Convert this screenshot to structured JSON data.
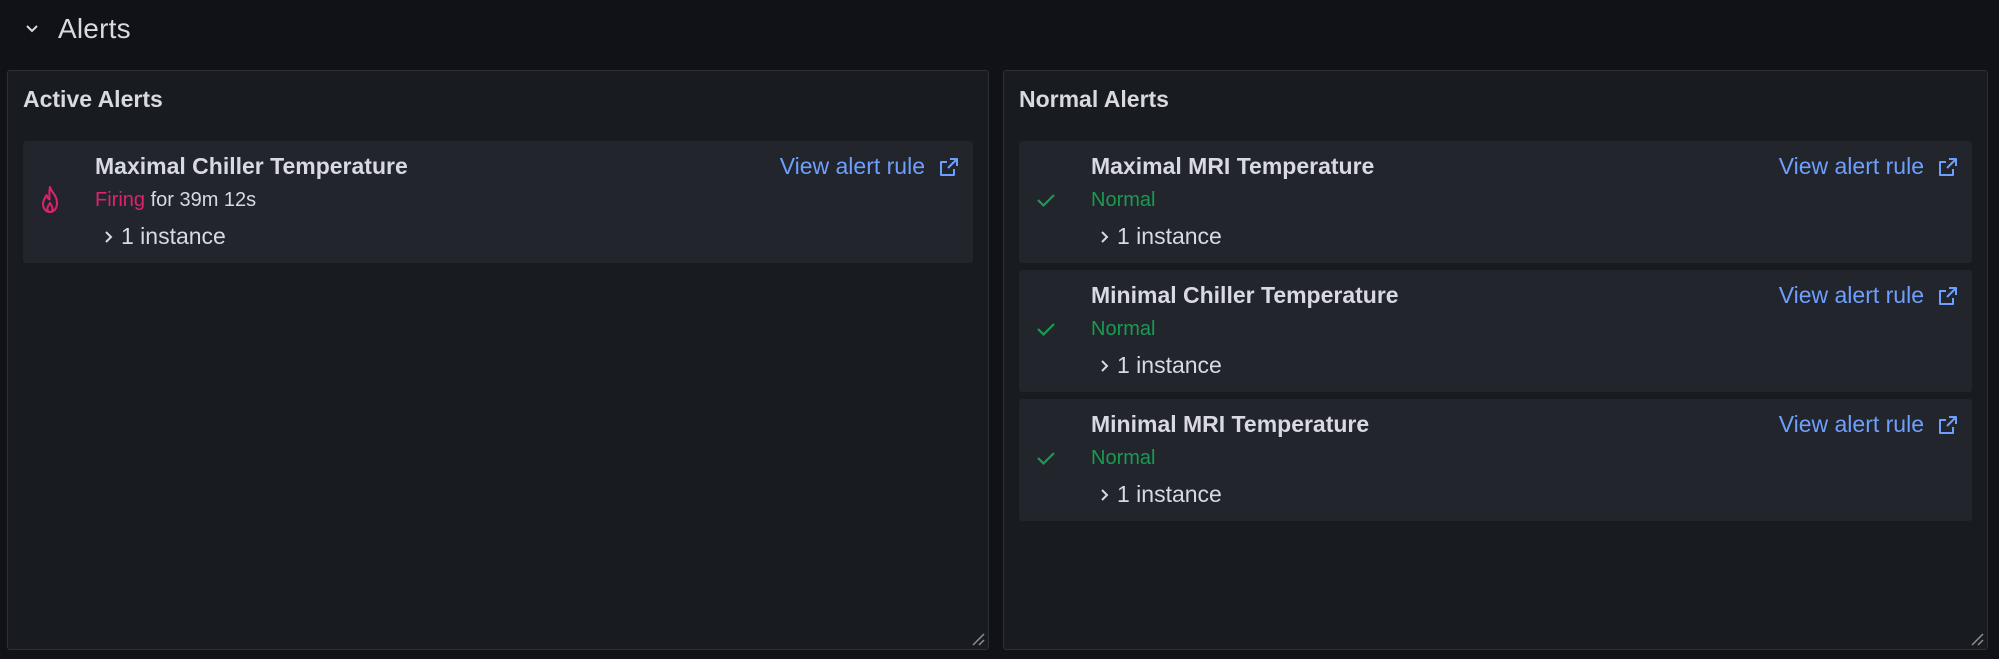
{
  "row": {
    "title": "Alerts",
    "collapse_icon": "chevron-down-icon"
  },
  "panels": [
    {
      "title": "Active Alerts",
      "alerts": [
        {
          "name": "Maximal Chiller Temperature",
          "state": "Firing",
          "duration": " for 39m 12s",
          "state_icon": "fire-icon",
          "instances": "1 instance",
          "link": "View alert rule"
        }
      ]
    },
    {
      "title": "Normal Alerts",
      "alerts": [
        {
          "name": "Maximal MRI Temperature",
          "state": "Normal",
          "state_icon": "check-icon",
          "instances": "1 instance",
          "link": "View alert rule"
        },
        {
          "name": "Minimal Chiller Temperature",
          "state": "Normal",
          "state_icon": "check-icon",
          "instances": "1 instance",
          "link": "View alert rule"
        },
        {
          "name": "Minimal MRI Temperature",
          "state": "Normal",
          "state_icon": "check-icon",
          "instances": "1 instance",
          "link": "View alert rule"
        }
      ]
    }
  ],
  "colors": {
    "background": "#111217",
    "panel": "#181b1f",
    "card": "#22252b",
    "firing": "#e0226e",
    "normal": "#1a9a52",
    "link": "#6e9fff"
  }
}
